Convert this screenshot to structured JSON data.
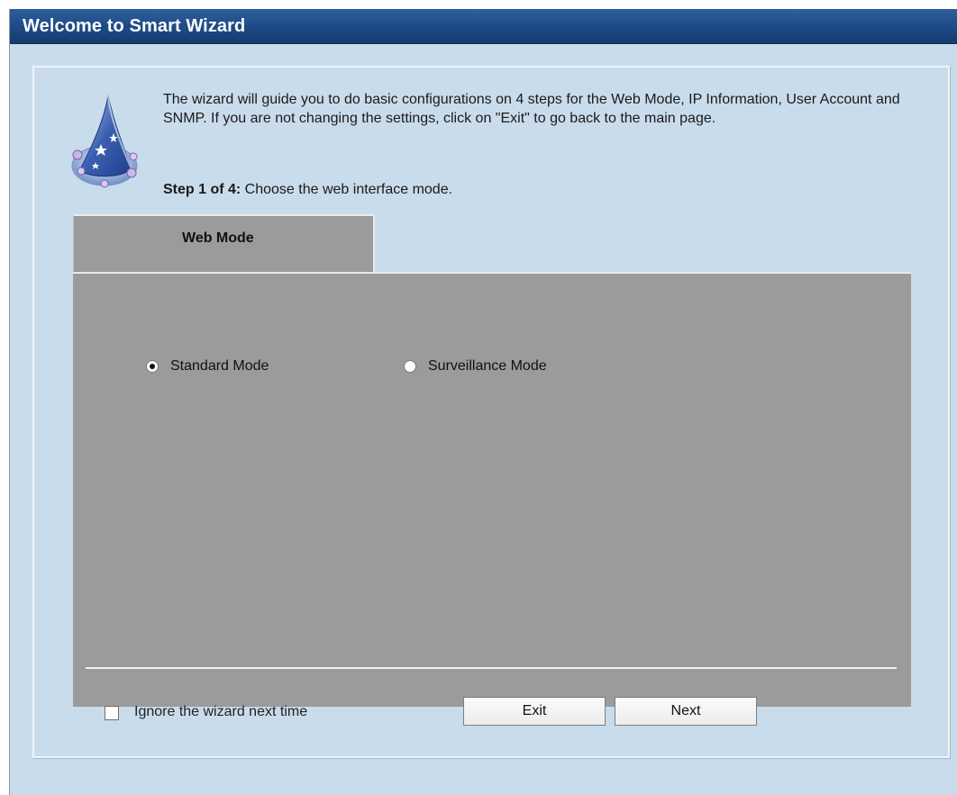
{
  "window": {
    "title": "Welcome to Smart Wizard"
  },
  "intro": {
    "text": "The wizard will guide you to do basic configurations on 4 steps for the Web Mode, IP Information, User Account and SNMP. If you are not changing the settings, click on \"Exit\" to go back to the main page.",
    "step_label": "Step 1 of 4:",
    "step_text": " Choose the web interface mode."
  },
  "tabs": [
    {
      "label": "Web Mode",
      "active": true
    }
  ],
  "modes": [
    {
      "label": "Standard Mode",
      "checked": true
    },
    {
      "label": "Surveillance Mode",
      "checked": false
    }
  ],
  "footer": {
    "ignore_label": "Ignore the wizard next time",
    "ignore_checked": false,
    "exit_label": "Exit",
    "next_label": "Next"
  },
  "colors": {
    "titlebar": "#1d4a86",
    "panel_background": "#c9dcec",
    "content_background": "#9b9b9b"
  },
  "icons": {
    "wizard": "wizard-hat-icon"
  }
}
